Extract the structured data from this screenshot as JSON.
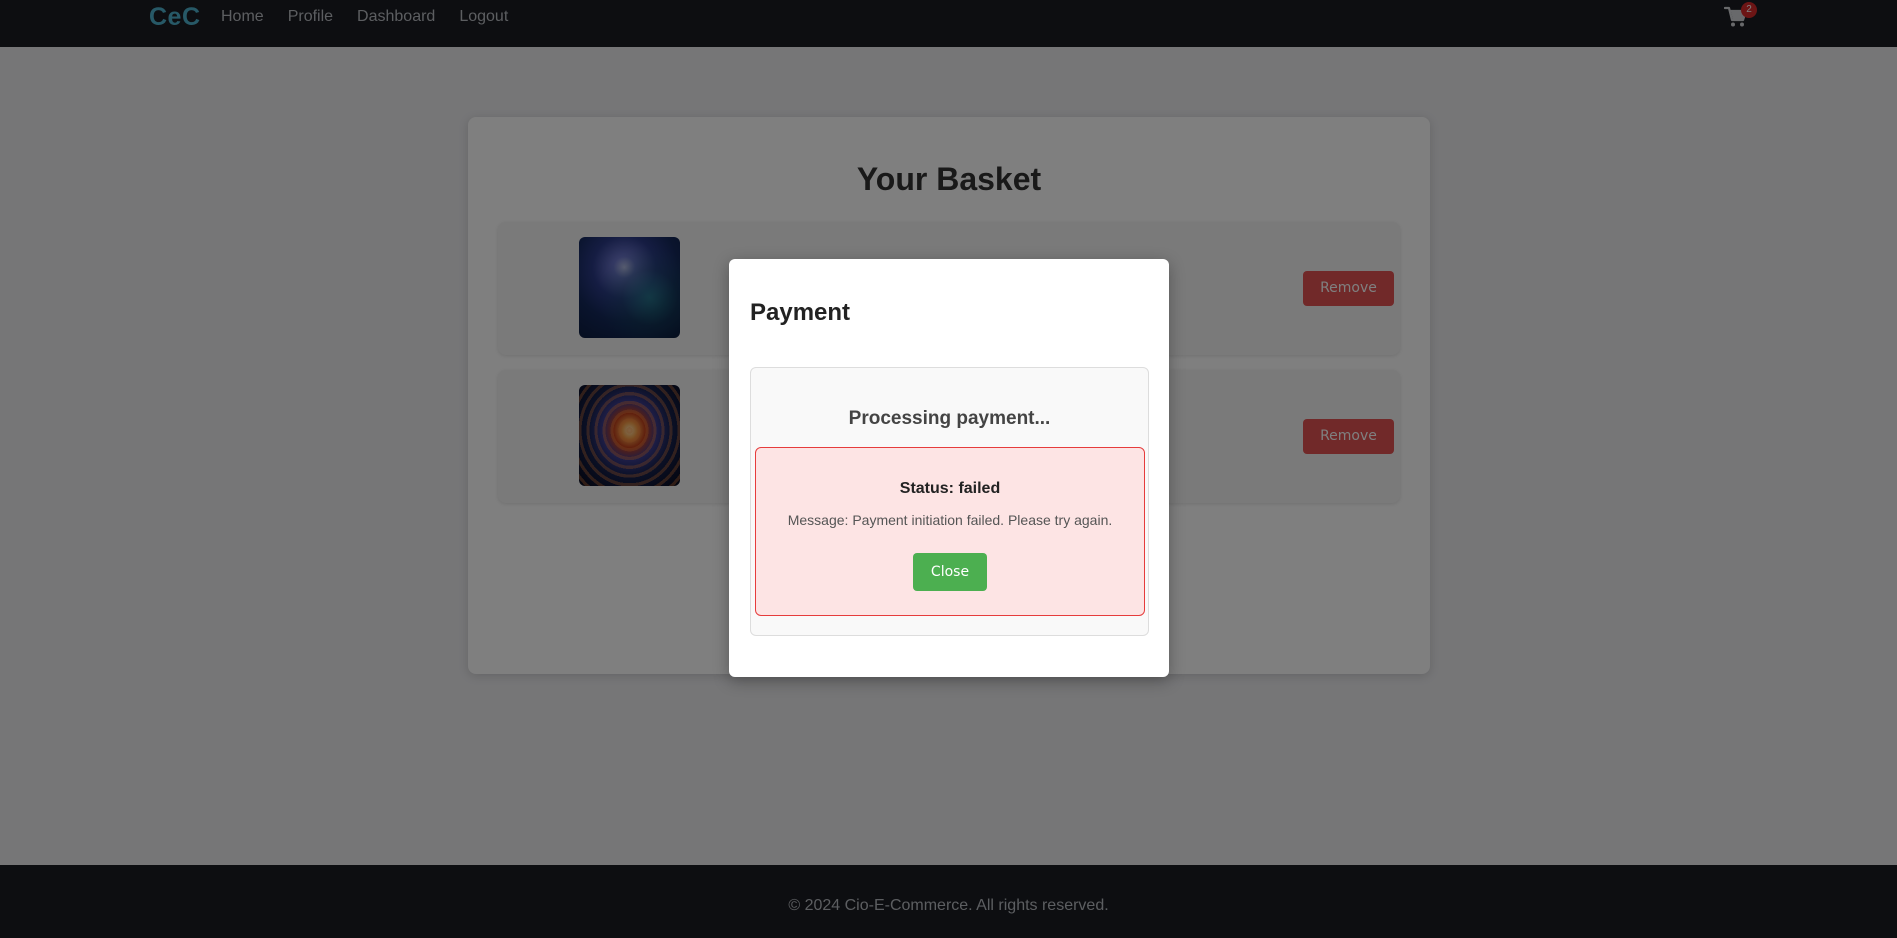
{
  "navbar": {
    "brand": "CeC",
    "links": [
      "Home",
      "Profile",
      "Dashboard",
      "Logout"
    ],
    "cart_count": "2"
  },
  "basket": {
    "title": "Your Basket",
    "items": [
      {
        "image": "nebula artwork",
        "remove_label": "Remove"
      },
      {
        "image": "spiral galaxy artwork",
        "remove_label": "Remove"
      }
    ]
  },
  "modal": {
    "title": "Payment",
    "processing_text": "Processing payment...",
    "status_text": "Status: failed",
    "message_text": "Message: Payment initiation failed. Please try again.",
    "close_label": "Close"
  },
  "footer": {
    "text": "© 2024 Cio-E-Commerce. All rights reserved."
  },
  "colors": {
    "brand": "#4fb3cf",
    "navbar_bg": "#1b1d22",
    "remove_button": "#e35252",
    "close_button": "#4caf50",
    "status_error_bg": "#fde4e4",
    "status_error_border": "#e63c3c",
    "cart_badge": "#d92b2b"
  }
}
